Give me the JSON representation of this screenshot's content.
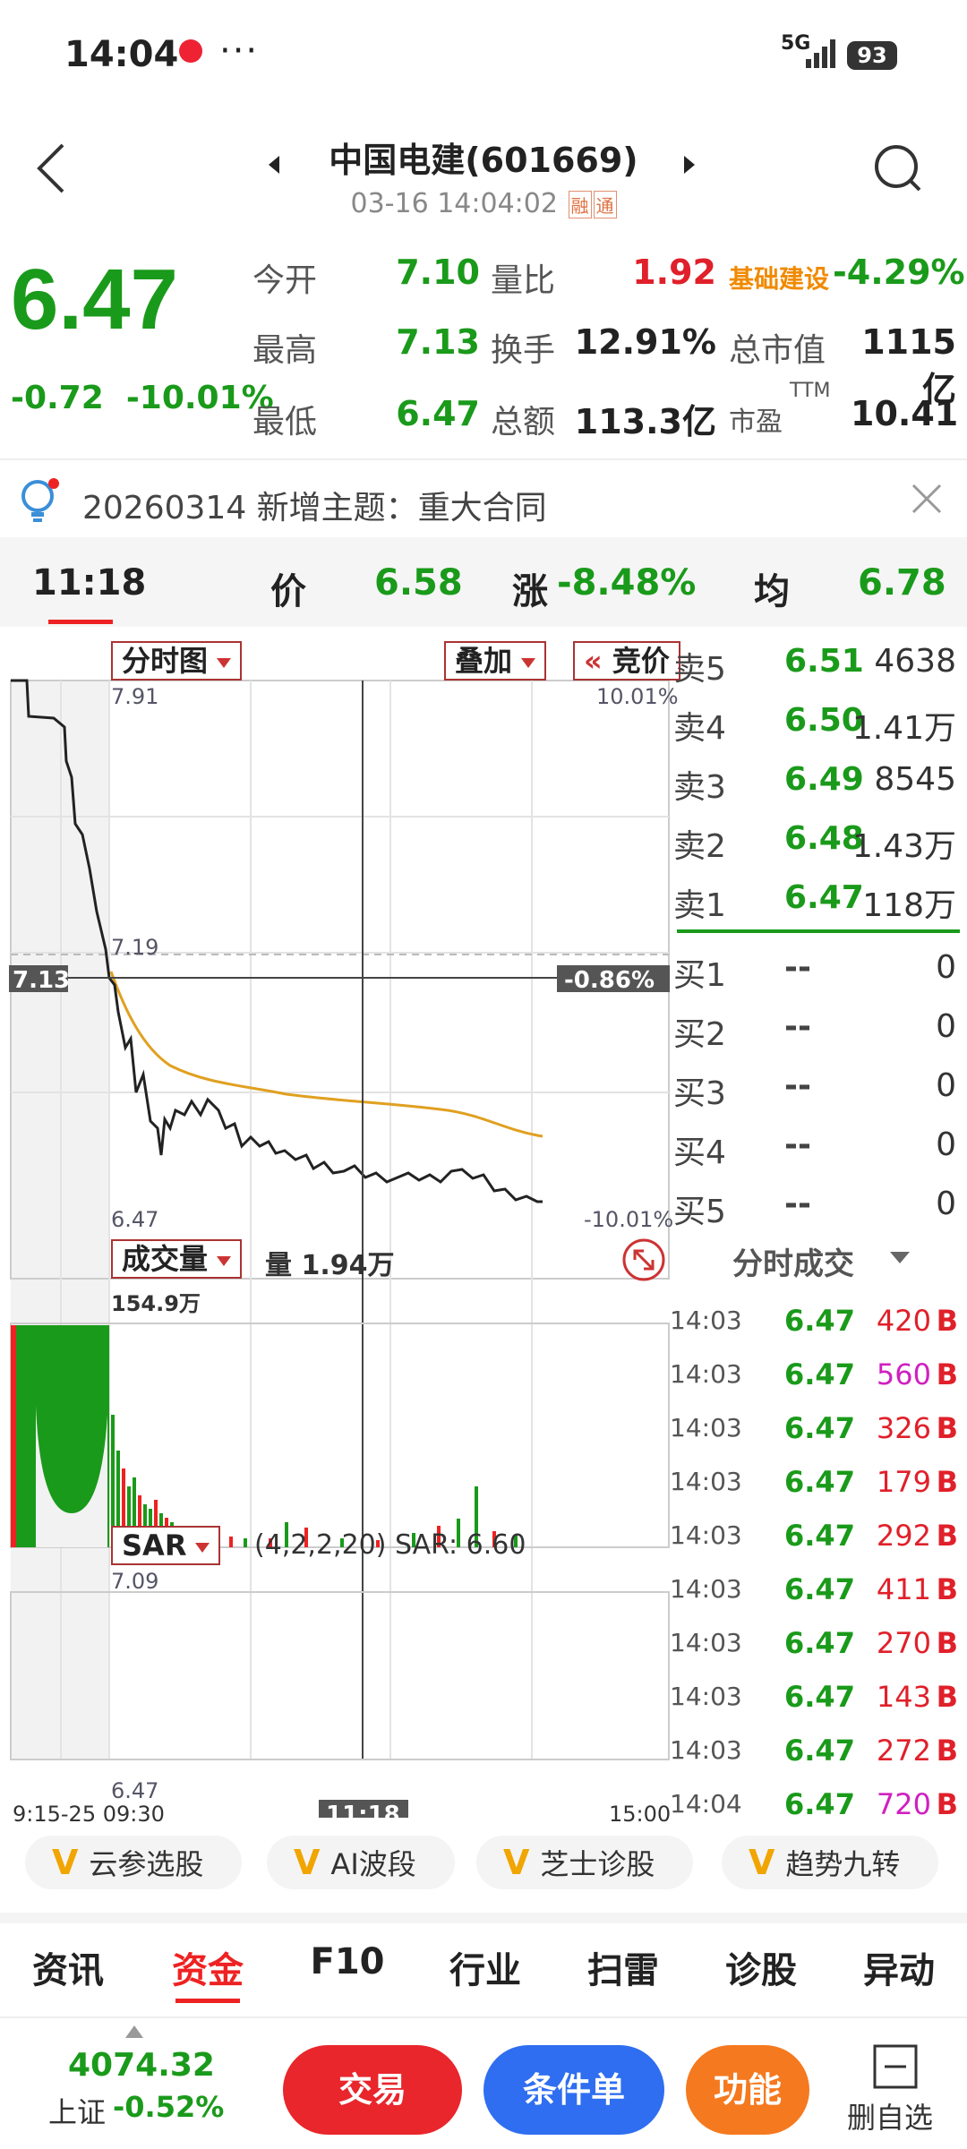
{
  "status_bar": {
    "time": "14:04",
    "dots": "···",
    "network": "5G",
    "battery": "93"
  },
  "header": {
    "title": "中国电建(601669)",
    "datetime": "03-16 14:04:02",
    "tags": [
      "融",
      "通"
    ],
    "icons": [
      "back-icon",
      "prev-arrow-icon",
      "next-arrow-icon",
      "search-icon"
    ]
  },
  "quote": {
    "price": "6.47",
    "change": "-0.72",
    "change_pct": "-10.01%",
    "fields": [
      {
        "label": "今开",
        "value": "7.10",
        "color": "#1a9a1a"
      },
      {
        "label": "最高",
        "value": "7.13",
        "color": "#1a9a1a"
      },
      {
        "label": "最低",
        "value": "6.47",
        "color": "#1a9a1a"
      },
      {
        "label": "量比",
        "value": "1.92",
        "color": "#e0202a"
      },
      {
        "label": "换手",
        "value": "12.91%",
        "color": "#222222"
      },
      {
        "label": "总额",
        "value": "113.3亿",
        "color": "#222222"
      },
      {
        "label": "基础建设",
        "value": "-4.29%",
        "color": "#1a9a1a"
      },
      {
        "label": "总市值",
        "value": "1115亿",
        "color": "#222222"
      },
      {
        "label": "市盈",
        "value": "10.41",
        "color": "#222222",
        "sup": "TTM"
      }
    ]
  },
  "notice": {
    "text": "20260314 新增主题：重大合同",
    "icon": "bulb-icon",
    "close": "close-icon"
  },
  "cursor": {
    "time": "11:18",
    "price_label": "价",
    "price": "6.58",
    "change_label": "涨",
    "change": "-8.48%",
    "avg_label": "均",
    "avg": "6.78"
  },
  "chart": {
    "mode_dropdown": "分时图",
    "overlay_dropdown": "叠加",
    "auction_button": "竞价",
    "price_high": "7.91",
    "price_mid": "7.19",
    "price_low": "6.47",
    "pct_high": "10.01%",
    "pct_low": "-10.01%",
    "cursor_price": "7.13",
    "cursor_pct": "-0.86%",
    "volume_dropdown": "成交量",
    "volume_text": "量 1.94万",
    "volume_max": "154.9万",
    "sar_dropdown": "SAR",
    "sar_text": "(4,2,2,20) SAR: 6.60",
    "sar_high": "7.09",
    "sar_low": "6.47",
    "time_start": "9:15-25 09:30",
    "time_cursor": "11:18",
    "time_end": "15:00"
  },
  "chart_data": {
    "type": "line",
    "series": [
      {
        "values_time": [
          "09:15",
          "09:20",
          "09:25",
          "09:30",
          "09:45",
          "10:00",
          "10:30",
          "11:00",
          "11:18",
          "11:30",
          "13:30",
          "14:00",
          "14:04"
        ],
        "price": [
          7.91,
          7.8,
          7.7,
          7.1,
          6.9,
          6.75,
          6.7,
          6.63,
          6.58,
          6.6,
          6.55,
          6.48,
          6.47
        ]
      },
      {
        "values_time": [
          "09:30",
          "10:00",
          "10:30",
          "11:00",
          "11:30",
          "13:30",
          "14:00",
          "14:04"
        ],
        "price": [
          7.1,
          6.92,
          6.85,
          6.8,
          6.78,
          6.76,
          6.72,
          6.72
        ]
      }
    ],
    "ylim": [
      6.47,
      7.91
    ]
  },
  "order_book": {
    "sell": [
      {
        "label": "卖5",
        "price": "6.51",
        "vol": "4638"
      },
      {
        "label": "卖4",
        "price": "6.50",
        "vol": "1.41万"
      },
      {
        "label": "卖3",
        "price": "6.49",
        "vol": "8545"
      },
      {
        "label": "卖2",
        "price": "6.48",
        "vol": "1.43万"
      },
      {
        "label": "卖1",
        "price": "6.47",
        "vol": "118万"
      }
    ],
    "buy": [
      {
        "label": "买1",
        "price": "--",
        "vol": "0"
      },
      {
        "label": "买2",
        "price": "--",
        "vol": "0"
      },
      {
        "label": "买3",
        "price": "--",
        "vol": "0"
      },
      {
        "label": "买4",
        "price": "--",
        "vol": "0"
      },
      {
        "label": "买5",
        "price": "--",
        "vol": "0"
      }
    ]
  },
  "ticks": {
    "title": "分时成交",
    "rows": [
      {
        "time": "14:03",
        "price": "6.47",
        "vol": "420",
        "side": "B",
        "color": "#e0202a"
      },
      {
        "time": "14:03",
        "price": "6.47",
        "vol": "560",
        "side": "B",
        "color": "#d020c0"
      },
      {
        "time": "14:03",
        "price": "6.47",
        "vol": "326",
        "side": "B",
        "color": "#e0202a"
      },
      {
        "time": "14:03",
        "price": "6.47",
        "vol": "179",
        "side": "B",
        "color": "#e0202a"
      },
      {
        "time": "14:03",
        "price": "6.47",
        "vol": "292",
        "side": "B",
        "color": "#e0202a"
      },
      {
        "time": "14:03",
        "price": "6.47",
        "vol": "411",
        "side": "B",
        "color": "#e0202a"
      },
      {
        "time": "14:03",
        "price": "6.47",
        "vol": "270",
        "side": "B",
        "color": "#e0202a"
      },
      {
        "time": "14:03",
        "price": "6.47",
        "vol": "143",
        "side": "B",
        "color": "#e0202a"
      },
      {
        "time": "14:03",
        "price": "6.47",
        "vol": "272",
        "side": "B",
        "color": "#e0202a"
      },
      {
        "time": "14:04",
        "price": "6.47",
        "vol": "720",
        "side": "B",
        "color": "#d020c0"
      }
    ]
  },
  "features": [
    "云参选股",
    "AI波段",
    "芝士诊股",
    "趋势九转"
  ],
  "tabs": [
    "资讯",
    "资金",
    "F10",
    "行业",
    "扫雷",
    "诊股",
    "异动"
  ],
  "active_tab": "资金",
  "bottom": {
    "index_value": "4074.32",
    "index_name": "上证",
    "index_change": "-0.52%",
    "trade_button": "交易",
    "condition_button": "条件单",
    "function_button": "功能",
    "remove_label": "删自选"
  },
  "colors": {
    "up": "#e0202a",
    "down": "#1a9a1a",
    "avg_line": "#e0a020"
  }
}
